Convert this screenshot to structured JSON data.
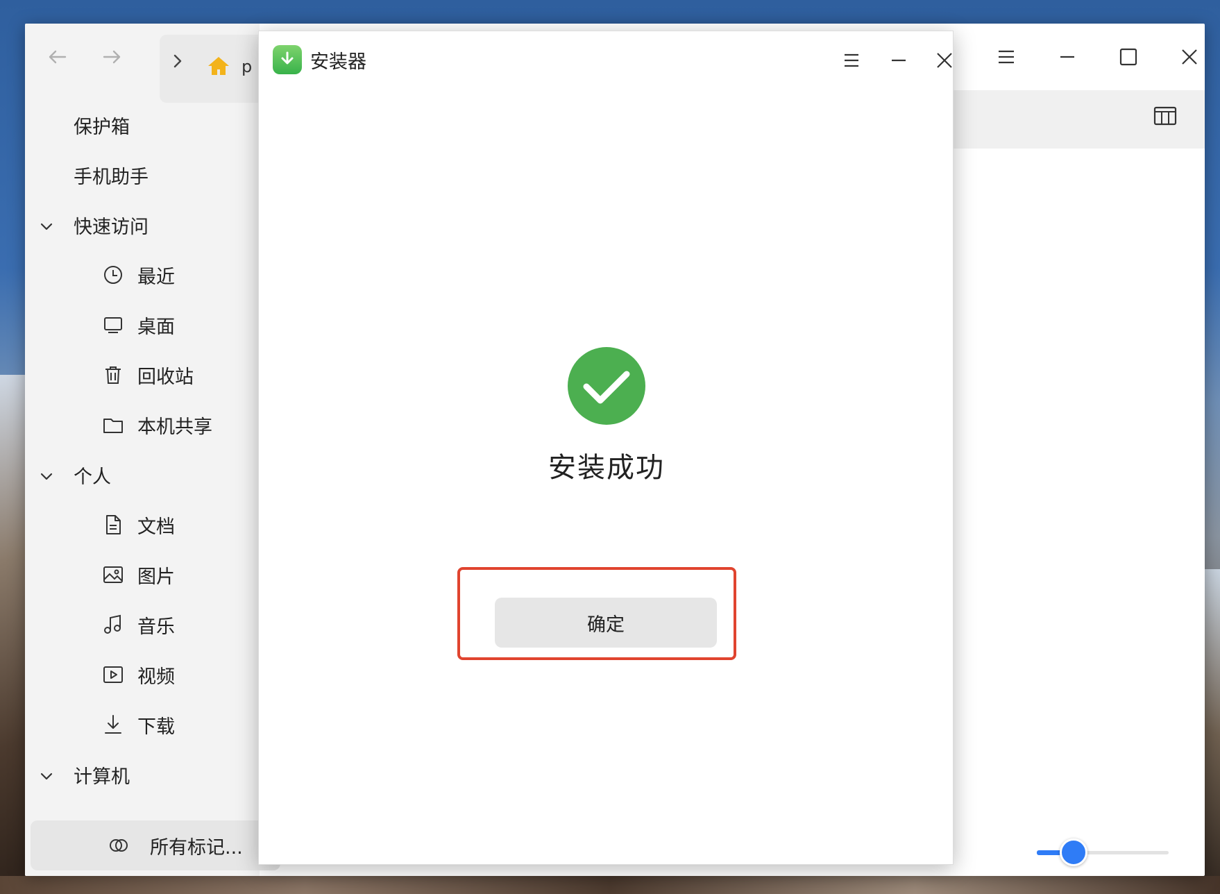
{
  "file_manager": {
    "breadcrumb": {
      "current_text": "p"
    },
    "sidebar": {
      "items": [
        {
          "label": "保护箱",
          "level": 0,
          "icon": ""
        },
        {
          "label": "手机助手",
          "level": 0,
          "icon": ""
        },
        {
          "label": "快速访问",
          "level": 0,
          "icon": "chevron-down-icon"
        },
        {
          "label": "最近",
          "level": 1,
          "icon": "clock-icon"
        },
        {
          "label": "桌面",
          "level": 1,
          "icon": "desktop-icon"
        },
        {
          "label": "回收站",
          "level": 1,
          "icon": "trash-icon"
        },
        {
          "label": "本机共享",
          "level": 1,
          "icon": "folder-icon"
        },
        {
          "label": "个人",
          "level": 0,
          "icon": "chevron-down-icon"
        },
        {
          "label": "文档",
          "level": 1,
          "icon": "document-icon"
        },
        {
          "label": "图片",
          "level": 1,
          "icon": "image-icon"
        },
        {
          "label": "音乐",
          "level": 1,
          "icon": "music-icon"
        },
        {
          "label": "视频",
          "level": 1,
          "icon": "video-icon"
        },
        {
          "label": "下载",
          "level": 1,
          "icon": "download-icon"
        },
        {
          "label": "计算机",
          "level": 0,
          "icon": "chevron-down-icon"
        }
      ],
      "tags_label": "所有标记..."
    },
    "zoom_slider_fraction": 0.28
  },
  "installer": {
    "title": "安装器",
    "status_text": "安装成功",
    "confirm_label": "确定"
  },
  "colors": {
    "accent": "#2f7cf6",
    "success": "#4caf50",
    "highlight": "#e0442f"
  }
}
